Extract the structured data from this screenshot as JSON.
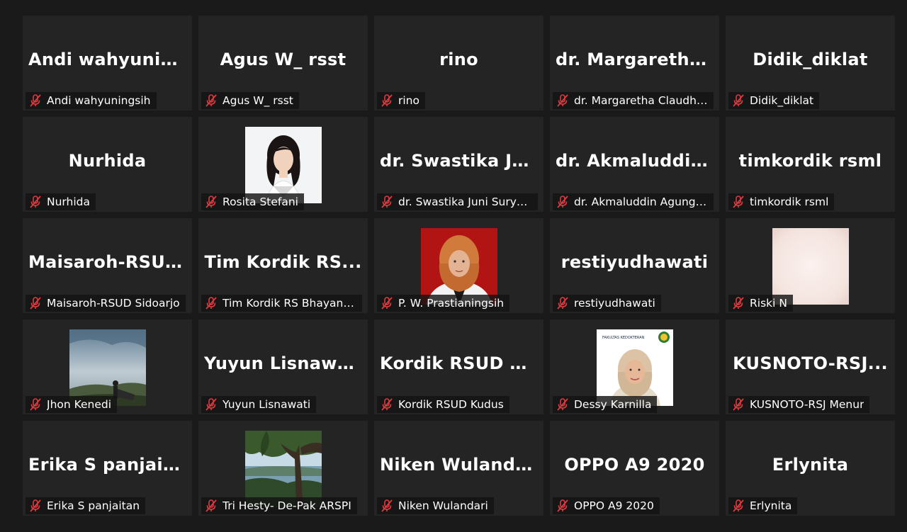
{
  "participants": [
    {
      "display": "Andi  wahyunin...",
      "label": "Andi wahyuningsih"
    },
    {
      "display": "Agus W_ rsst",
      "label": "Agus W_ rsst"
    },
    {
      "display": "rino",
      "label": "rino"
    },
    {
      "display": "dr.  Margaretha...",
      "label": "dr. Margaretha Claudhya ..."
    },
    {
      "display": "Didik_diklat",
      "label": "Didik_diklat"
    },
    {
      "display": "Nurhida",
      "label": "Nurhida"
    },
    {
      "display": "",
      "label": "Rosita Stefani",
      "photo": "woman-portrait"
    },
    {
      "display": "dr.  Swastika  Jun...",
      "label": "dr. Swastika Juni Suryand..."
    },
    {
      "display": "dr.  Akmaluddin...",
      "label": "dr. Akmaluddin Agung P, ..."
    },
    {
      "display": "timkordik rsml",
      "label": "timkordik rsml"
    },
    {
      "display": "Maisaroh-RSUD...",
      "label": "Maisaroh-RSUD Sidoarjo"
    },
    {
      "display": "Tim  Kordik  RS...",
      "label": "Tim Kordik RS Bhayangka..."
    },
    {
      "display": "",
      "label": "P. W. Prastianingsih",
      "photo": "hijab-portrait-red"
    },
    {
      "display": "restiyudhawati",
      "label": "restiyudhawati"
    },
    {
      "display": "",
      "label": "Riski N",
      "photo": "blurred-light"
    },
    {
      "display": "",
      "label": "Jhon Kenedi",
      "photo": "landscape-person"
    },
    {
      "display": "Yuyun Lisnawati",
      "label": "Yuyun Lisnawati"
    },
    {
      "display": "Kordik  RSUD  K...",
      "label": "Kordik RSUD Kudus"
    },
    {
      "display": "",
      "label": "Dessy Karnilla",
      "photo": "hijab-portrait-white",
      "photo_text": "FAKULTAS KEDOKTERAN"
    },
    {
      "display": "KUSNOTO-RSJ...",
      "label": "KUSNOTO-RSJ Menur"
    },
    {
      "display": "Erika S panjaitan",
      "label": "Erika S panjaitan"
    },
    {
      "display": "",
      "label": "Tri Hesty- De-Pak ARSPI",
      "photo": "tree-landscape"
    },
    {
      "display": "Niken Wulandari",
      "label": "Niken Wulandari"
    },
    {
      "display": "OPPO A9 2020",
      "label": "OPPO A9 2020"
    },
    {
      "display": "Erlynita",
      "label": "Erlynita"
    }
  ],
  "icons": {
    "mic": "mic-muted-icon"
  },
  "colors": {
    "background": "#1a1a1a",
    "tile": "#242424",
    "muted": "#e0393e"
  }
}
